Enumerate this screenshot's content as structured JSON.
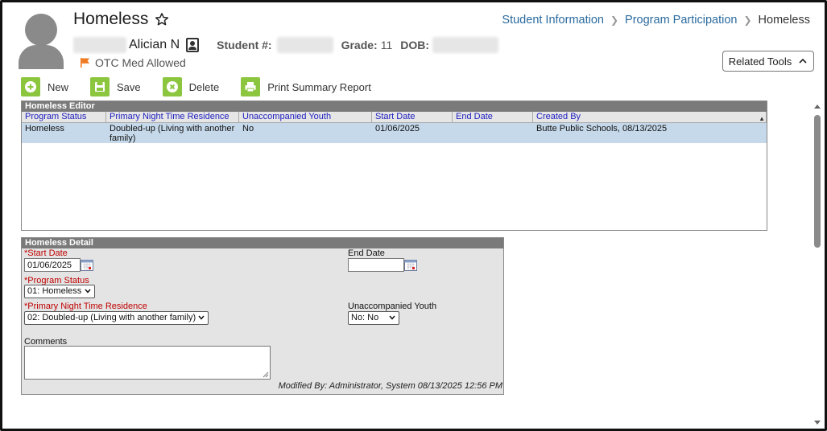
{
  "page": {
    "title": "Homeless",
    "breadcrumb": [
      {
        "label": "Student Information"
      },
      {
        "label": "Program Participation"
      },
      {
        "label": "Homeless"
      }
    ]
  },
  "student": {
    "name": "Alician N",
    "student_number_label": "Student #:",
    "grade_label": "Grade:",
    "grade": "11",
    "dob_label": "DOB:",
    "flag_text": "OTC Med Allowed",
    "flag_color": "#f07a22"
  },
  "related_tools": {
    "label": "Related Tools"
  },
  "toolbar": {
    "new_label": "New",
    "save_label": "Save",
    "delete_label": "Delete",
    "print_label": "Print Summary Report",
    "icon_color": "#8cc63f"
  },
  "editor": {
    "title": "Homeless Editor",
    "columns": [
      "Program Status",
      "Primary Night Time Residence",
      "Unaccompanied Youth",
      "Start Date",
      "End Date",
      "Created By"
    ],
    "rows": [
      [
        "Homeless",
        "Doubled-up (Living with another family)",
        "No",
        "01/06/2025",
        "",
        "Butte Public Schools, 08/13/2025"
      ]
    ]
  },
  "detail": {
    "title": "Homeless Detail",
    "start_date_label": "*Start Date",
    "start_date_value": "01/06/2025",
    "end_date_label": "End Date",
    "end_date_value": "",
    "program_status_label": "*Program Status",
    "program_status_value": "01: Homeless",
    "residence_label": "*Primary Night Time Residence",
    "residence_value": "02: Doubled-up (Living with another family)",
    "unaccompanied_label": "Unaccompanied Youth",
    "unaccompanied_value": "No: No",
    "comments_label": "Comments",
    "modified_text": "Modified By: Administrator, System 08/13/2025 12:56 PM"
  }
}
